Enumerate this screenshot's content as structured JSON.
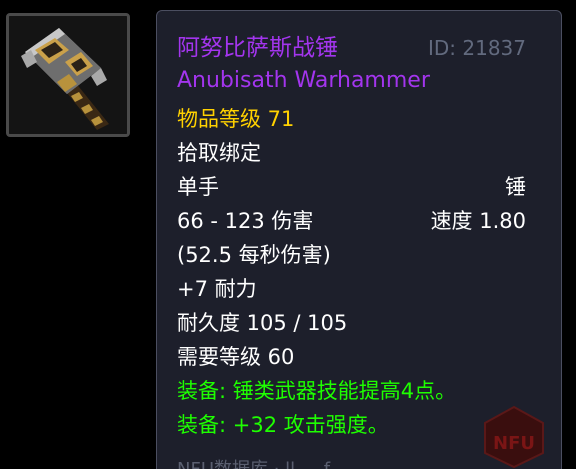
{
  "item": {
    "name_cn": "阿努比萨斯战锤",
    "name_en": "Anubisath Warhammer",
    "id_label": "ID: 21837",
    "item_level": "物品等级 71",
    "bind": "拾取绑定",
    "slot": "单手",
    "type": "锤",
    "damage": "66 - 123 伤害",
    "speed": "速度 1.80",
    "dps": "(52.5 每秒伤害)",
    "stamina": "+7 耐力",
    "durability": "耐久度 105 / 105",
    "required_level": "需要等级 60",
    "equip_effects": [
      "装备: 锤类武器技能提高4点。",
      "装备: +32 攻击强度。"
    ]
  },
  "footer": {
    "partial_text": "NFU数据库 · ll ... f"
  },
  "watermark": {
    "text": "NFU"
  },
  "colors": {
    "epic": "#a335ee",
    "item_level": "#ffd100",
    "equip": "#1eff00",
    "id": "#626a7e",
    "tooltip_bg": "#1d1f2b",
    "watermark": "#7a1515"
  },
  "icons": {
    "item_icon": "warhammer-icon"
  }
}
